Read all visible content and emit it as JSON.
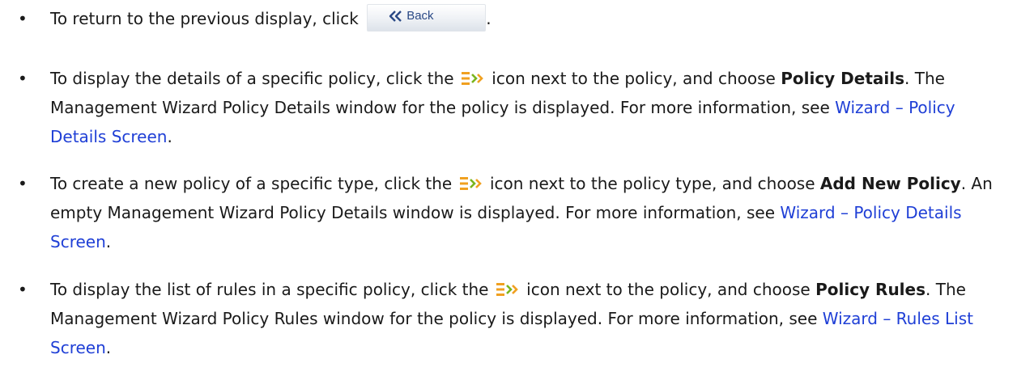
{
  "items": [
    {
      "bullet": "•",
      "before": "To return to the previous display, click ",
      "back_button_label": "Back",
      "after": "."
    },
    {
      "bullet": "•",
      "t1": "To display the details of a specific policy, click the ",
      "t2": " icon next to the policy, and choose ",
      "bold": "Policy Details",
      "t3": ". The Management Wizard Policy Details window for the policy is displayed. For more information, see ",
      "link": "Wizard – Policy Details Screen",
      "t4": "."
    },
    {
      "bullet": "•",
      "t1": "To create a new policy of a specific type, click the ",
      "t2": " icon next to the policy type, and choose ",
      "bold": "Add New Policy",
      "t3": ". An empty Management Wizard Policy Details window is displayed. For more information, see ",
      "link": "Wizard – Policy Details Screen",
      "t4": "."
    },
    {
      "bullet": "•",
      "t1": "To display the list of rules in a specific policy, click the ",
      "t2": " icon next to the policy, and choose ",
      "bold": "Policy Rules",
      "t3": ". The Management Wizard Policy Rules window for the policy is displayed. For more information, see ",
      "link": "Wizard – Rules List Screen",
      "t4": "."
    }
  ],
  "icons": {
    "back": "double-chevron-left-icon",
    "menu": "list-menu-icon"
  },
  "colors": {
    "link": "#1f3fd6",
    "icon_orange": "#f0a020",
    "icon_green": "#7ab51d",
    "back_label": "#2b4a86"
  }
}
